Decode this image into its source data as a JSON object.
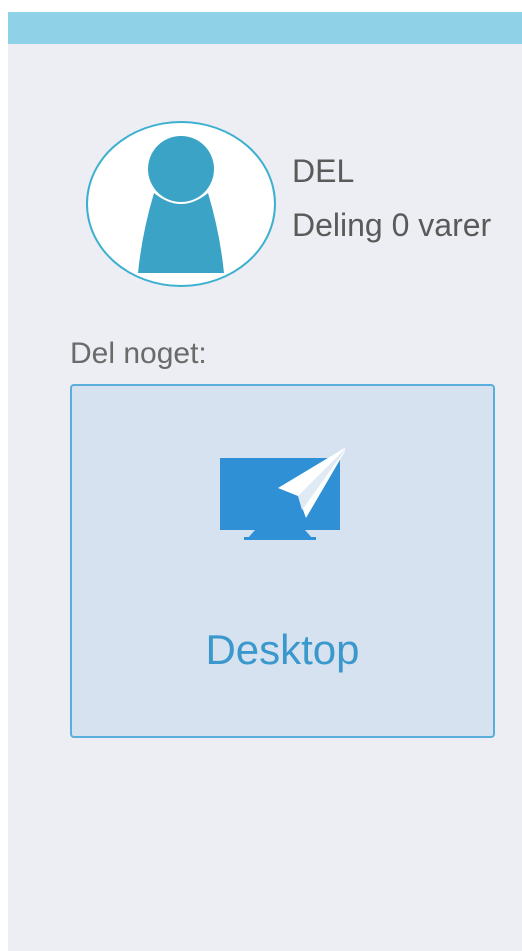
{
  "header": {
    "bar_color": "#8fd2e7"
  },
  "profile": {
    "avatar_icon": "user-silhouette-icon",
    "name": "DEL",
    "status": "Deling 0 varer"
  },
  "share": {
    "label": "Del noget:",
    "tiles": [
      {
        "icon": "monitor-paper-plane-icon",
        "label": "Desktop"
      }
    ]
  },
  "colors": {
    "accent": "#3a98cc",
    "avatar_fill": "#3aa3c6",
    "tile_bg": "#d6e2ef",
    "background": "#eceef3"
  }
}
